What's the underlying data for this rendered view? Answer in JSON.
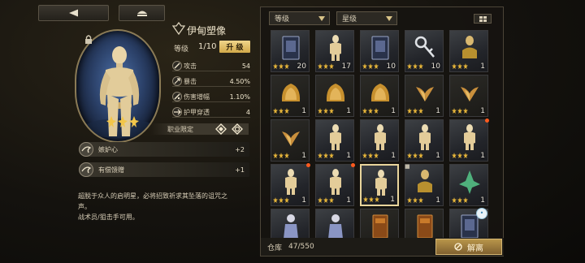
{
  "top_buttons": {
    "back_icon": "back-arrow-icon",
    "home_icon": "home-icon"
  },
  "character": {
    "name": "伊甸塑像",
    "level_label": "等级",
    "level_value": "1/10",
    "upgrade_label": "升 级",
    "stars": 3,
    "stats": [
      {
        "name": "攻击",
        "value": "54"
      },
      {
        "name": "暴击",
        "value": "4.50%"
      },
      {
        "name": "伤害增幅",
        "value": "1.10%"
      },
      {
        "name": "护甲穿透",
        "value": "4"
      }
    ],
    "job_limit_label": "职业限定"
  },
  "skills": [
    {
      "name": "嫉妒心",
      "bonus": "+2"
    },
    {
      "name": "有偿馈赠",
      "bonus": "+1"
    }
  ],
  "description": {
    "line1": "超脱于众人的启明星，必将招致祈求其坠落的诅咒之",
    "line2": "声。",
    "line3": "战术员/狙击手可用。"
  },
  "inventory": {
    "grade_filter": "等级",
    "star_filter": "星级",
    "rows": [
      [
        {
          "kind": "card",
          "stars": 3,
          "count": "20"
        },
        {
          "kind": "statue",
          "stars": 3,
          "count": "17"
        },
        {
          "kind": "card",
          "stars": 3,
          "count": "10"
        },
        {
          "kind": "key",
          "stars": 3,
          "count": "10"
        },
        {
          "kind": "bust",
          "stars": 3,
          "count": "1"
        }
      ],
      [
        {
          "kind": "gold",
          "stars": 3,
          "count": "1"
        },
        {
          "kind": "gold",
          "stars": 3,
          "count": "1"
        },
        {
          "kind": "gold",
          "stars": 3,
          "count": "1"
        },
        {
          "kind": "wings",
          "stars": 3,
          "count": "1"
        },
        {
          "kind": "wings",
          "stars": 3,
          "count": "1"
        }
      ],
      [
        {
          "kind": "wings",
          "stars": 3,
          "count": "1"
        },
        {
          "kind": "statue",
          "stars": 3,
          "count": "1"
        },
        {
          "kind": "statue",
          "stars": 3,
          "count": "1"
        },
        {
          "kind": "statue",
          "stars": 3,
          "count": "1"
        },
        {
          "kind": "statue",
          "stars": 3,
          "count": "1"
        }
      ],
      [
        {
          "kind": "statue",
          "stars": 3,
          "count": "1"
        },
        {
          "kind": "statue",
          "stars": 3,
          "count": "1"
        },
        {
          "kind": "statue",
          "stars": 3,
          "count": "1"
        },
        {
          "kind": "bust",
          "stars": 3,
          "count": "1"
        },
        {
          "kind": "crystal",
          "stars": 3,
          "count": "1"
        }
      ],
      [
        {
          "kind": "figure",
          "stars": 0,
          "count": ""
        },
        {
          "kind": "figure",
          "stars": 0,
          "count": ""
        },
        {
          "kind": "book",
          "stars": 0,
          "count": ""
        },
        {
          "kind": "book",
          "stars": 0,
          "count": ""
        },
        {
          "kind": "card",
          "stars": 0,
          "count": ""
        }
      ]
    ],
    "warehouse_label": "仓库",
    "warehouse_count": "47/550",
    "dismantle_label": "解离"
  }
}
